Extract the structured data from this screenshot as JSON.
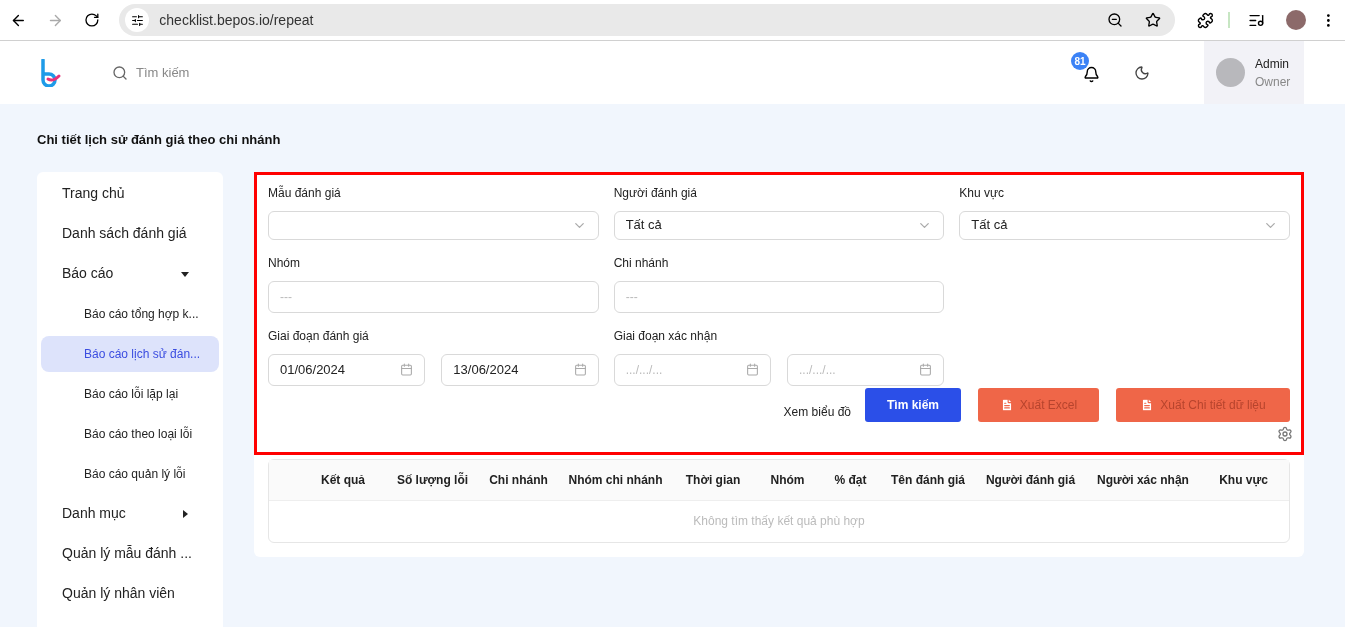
{
  "browser": {
    "url": "checklist.bepos.io/repeat",
    "forward_disabled": true
  },
  "header": {
    "search_placeholder": "Tìm kiếm",
    "notification_count": "81",
    "user": {
      "name": "Admin",
      "role": "Owner"
    }
  },
  "page_title": "Chi tiết lịch sử đánh giá theo chi nhánh",
  "sidebar": {
    "items": [
      {
        "label": "Trang chủ",
        "kind": "item",
        "selected": false
      },
      {
        "label": "Danh sách đánh giá",
        "kind": "item",
        "selected": false
      },
      {
        "label": "Báo cáo",
        "kind": "group",
        "expanded": true,
        "selected": false,
        "children": [
          {
            "label": "Báo cáo tổng hợp k...",
            "selected": false
          },
          {
            "label": "Báo cáo lịch sử đán...",
            "selected": true
          },
          {
            "label": "Báo cáo lỗi lặp lại",
            "selected": false
          },
          {
            "label": "Báo cáo theo loại lỗi",
            "selected": false
          },
          {
            "label": "Báo cáo quản lý lỗi",
            "selected": false
          }
        ]
      },
      {
        "label": "Danh mục",
        "kind": "group",
        "expanded": false,
        "selected": false
      },
      {
        "label": "Quản lý mẫu đánh ...",
        "kind": "item",
        "selected": false
      },
      {
        "label": "Quản lý nhân viên",
        "kind": "item",
        "selected": false
      }
    ]
  },
  "filters": {
    "rows": [
      [
        {
          "label": "Mẫu đánh giá",
          "kind": "select"
        },
        {
          "label": "Người đánh giá",
          "kind": "select",
          "value": "Tất cả"
        },
        {
          "label": "Khu vực",
          "kind": "select",
          "value": "Tất cả"
        }
      ],
      [
        {
          "label": "Nhóm",
          "kind": "text",
          "placeholder": "---"
        },
        {
          "label": "Chi nhánh",
          "kind": "text",
          "placeholder": "---"
        }
      ],
      [
        {
          "label": "Giai đoạn đánh giá",
          "kind": "daterange",
          "from": {
            "value": "01/06/2024"
          },
          "to": {
            "value": "13/06/2024"
          }
        },
        {
          "label": "Giai đoạn xác nhận",
          "kind": "daterange",
          "from": {
            "placeholder": ".../.../..."
          },
          "to": {
            "placeholder": ".../.../..."
          }
        }
      ]
    ],
    "chart_link": "Xem biểu đồ",
    "search_button": "Tìm kiếm",
    "export_buttons": [
      {
        "label": "Xuất Excel",
        "disabled": true
      },
      {
        "label": "Xuất Chi tiết dữ liệu",
        "disabled": true
      }
    ]
  },
  "table": {
    "columns": [
      "Kết quả",
      "Số lượng lỗi",
      "Chi nhánh",
      "Nhóm chi nhánh",
      "Thời gian",
      "Nhóm",
      "% đạt",
      "Tên đánh giá",
      "Người đánh giá",
      "Người xác nhận",
      "Khu vực"
    ],
    "empty_message": "Không tìm thấy kết quả phù hợp"
  }
}
